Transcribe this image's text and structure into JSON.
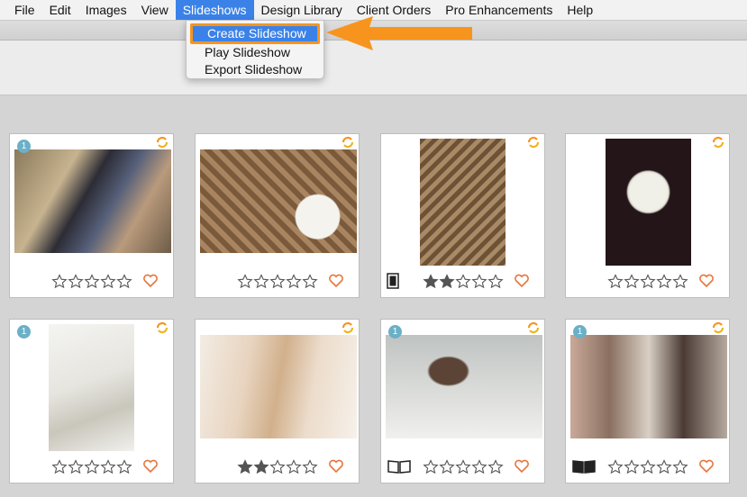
{
  "menubar": {
    "items": [
      "File",
      "Edit",
      "Images",
      "View",
      "Slideshows",
      "Design Library",
      "Client Orders",
      "Pro Enhancements",
      "Help"
    ],
    "active": "Slideshows"
  },
  "dropdown": {
    "items": [
      "Create Slideshow",
      "Play Slideshow",
      "Export Slideshow"
    ],
    "highlighted": "Create Slideshow"
  },
  "colors": {
    "accent": "#3b82e8",
    "callout": "#f7941d",
    "heart": "#e8743b",
    "badge": "#6ab0c7"
  },
  "cards": [
    {
      "badge": "1",
      "rating": 0,
      "icon": ""
    },
    {
      "badge": "",
      "rating": 0,
      "icon": ""
    },
    {
      "badge": "",
      "rating": 2,
      "icon": "tablet-icon"
    },
    {
      "badge": "",
      "rating": 0,
      "icon": ""
    },
    {
      "badge": "1",
      "rating": 0,
      "icon": ""
    },
    {
      "badge": "",
      "rating": 2,
      "icon": ""
    },
    {
      "badge": "1",
      "rating": 0,
      "icon": "open-book-icon"
    },
    {
      "badge": "1",
      "rating": 0,
      "icon": "closed-book-icon"
    }
  ]
}
